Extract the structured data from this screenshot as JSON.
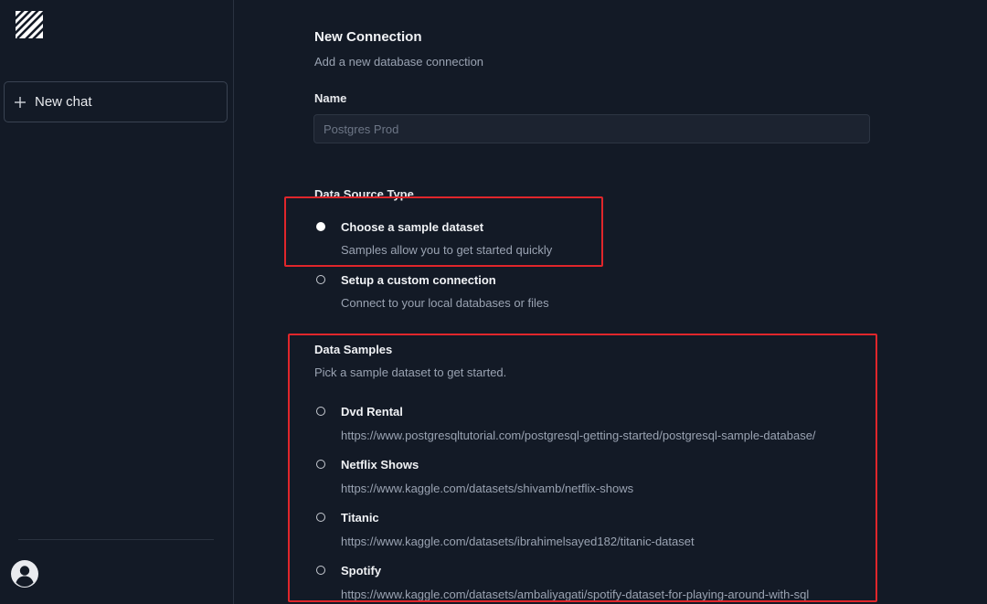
{
  "sidebar": {
    "logo_icon": "striped-square-logo",
    "new_chat_label": "New chat",
    "avatar_icon": "user-avatar-icon"
  },
  "form": {
    "title": "New Connection",
    "subtitle": "Add a new database connection",
    "name_label": "Name",
    "name_placeholder": "Postgres Prod",
    "name_value": "",
    "data_source_type_label": "Data Source Type",
    "source_options": [
      {
        "title": "Choose a sample dataset",
        "description": "Samples allow you to get started quickly",
        "selected": true
      },
      {
        "title": "Setup a custom connection",
        "description": "Connect to your local databases or files",
        "selected": false
      }
    ],
    "samples": {
      "label": "Data Samples",
      "description": "Pick a sample dataset to get started.",
      "items": [
        {
          "title": "Dvd Rental",
          "url": "https://www.postgresqltutorial.com/postgresql-getting-started/postgresql-sample-database/",
          "selected": false
        },
        {
          "title": "Netflix Shows",
          "url": "https://www.kaggle.com/datasets/shivamb/netflix-shows",
          "selected": false
        },
        {
          "title": "Titanic",
          "url": "https://www.kaggle.com/datasets/ibrahimelsayed182/titanic-dataset",
          "selected": false
        },
        {
          "title": "Spotify",
          "url": "https://www.kaggle.com/datasets/ambaliyagati/spotify-dataset-for-playing-around-with-sql",
          "selected": false
        }
      ]
    }
  },
  "colors": {
    "background": "#131a26",
    "highlight": "#e0262b"
  }
}
